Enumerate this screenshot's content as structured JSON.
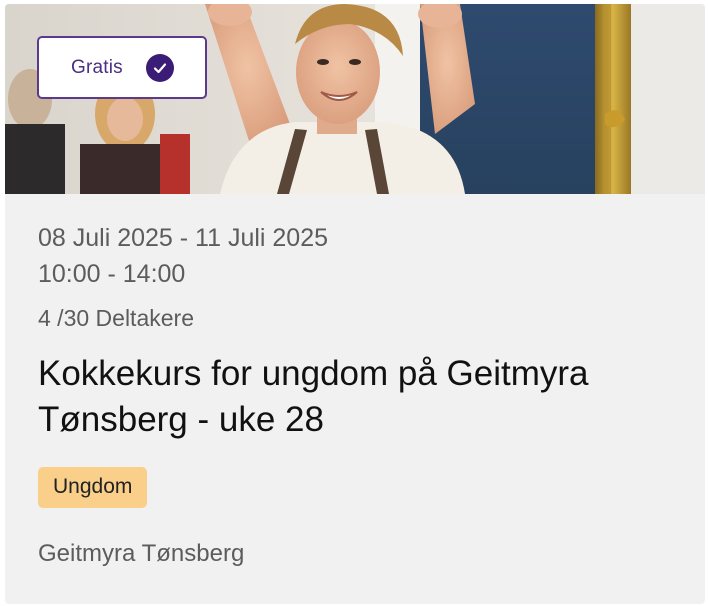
{
  "badge": {
    "label": "Gratis",
    "icon": "check-circle-icon",
    "color": "#3b1d78"
  },
  "hero": {
    "image": "young-cook-photo"
  },
  "event": {
    "date_range": "08 Juli 2025 - 11 Juli 2025",
    "time_range": "10:00 - 14:00",
    "participants": "4 /30 Deltakere",
    "title": "Kokkekurs for ungdom på Geitmyra Tønsberg - uke 28",
    "category": "Ungdom",
    "location": "Geitmyra Tønsberg"
  },
  "colors": {
    "card_background": "#f1f1f2",
    "tag_background": "#f9cf8a",
    "accent": "#4b2e86"
  }
}
